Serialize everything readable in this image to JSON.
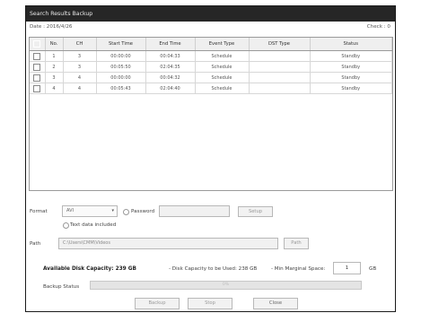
{
  "dialog": {
    "title": "Search Results Backup",
    "date_text": "Date : 2016/4/26",
    "check_text": "Check : 0"
  },
  "table": {
    "headers": [
      "No.",
      "CH",
      "Start Time",
      "End Time",
      "Event Type",
      "DST Type",
      "Status"
    ],
    "rows": [
      {
        "no": "1",
        "ch": "3",
        "start": "00:00:00",
        "end": "00:04:33",
        "event": "Schedule",
        "dst": "",
        "status": "Standby"
      },
      {
        "no": "2",
        "ch": "3",
        "start": "00:05:50",
        "end": "02:04:35",
        "event": "Schedule",
        "dst": "",
        "status": "Standby"
      },
      {
        "no": "3",
        "ch": "4",
        "start": "00:00:00",
        "end": "00:04:32",
        "event": "Schedule",
        "dst": "",
        "status": "Standby"
      },
      {
        "no": "4",
        "ch": "4",
        "start": "00:05:43",
        "end": "02:04:40",
        "event": "Schedule",
        "dst": "",
        "status": "Standby"
      }
    ]
  },
  "format": {
    "label": "Format",
    "value": "AVI",
    "password_label": "Password",
    "password_value": "",
    "setup_label": "Setup",
    "text_data_label": "Text data included"
  },
  "path": {
    "label": "Path",
    "value": "C:\\Users\\CMM\\Videos",
    "button_label": "Path"
  },
  "disk": {
    "available": "Available Disk Capacity: 239 GB",
    "to_be_used": "- Disk Capacity to be Used: 238 GB",
    "min_space_label": "- Min Marginal Space:",
    "min_space_value": "1",
    "min_space_unit": "GB"
  },
  "backup_status": {
    "label": "Backup Status",
    "progress_text": "0%",
    "progress_fraction": 0
  },
  "buttons": {
    "backup": "Backup",
    "stop": "Stop",
    "close": "Close"
  },
  "colors": {
    "titlebar": "#262626",
    "table_header": "#efefef",
    "progress_bg": "#e4e4e4"
  }
}
